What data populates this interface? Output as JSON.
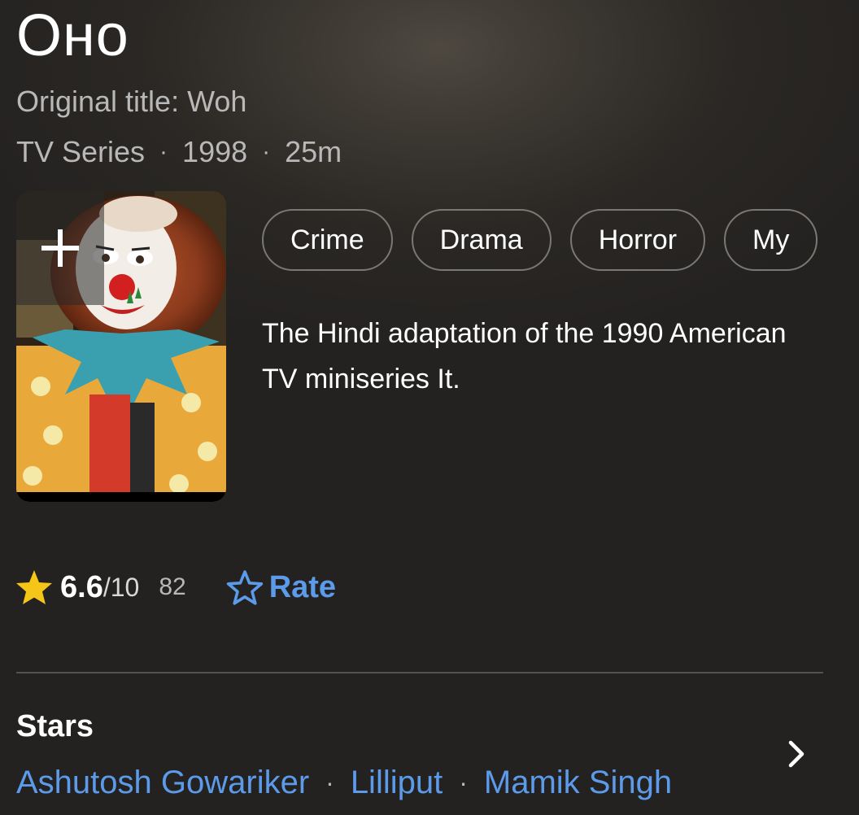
{
  "header": {
    "title": "Оно",
    "original_title": "Original title: Woh",
    "type": "TV Series",
    "year": "1998",
    "runtime": "25m",
    "separator": "·"
  },
  "poster": {
    "add_icon": "plus-icon"
  },
  "genres": [
    "Crime",
    "Drama",
    "Horror",
    "My"
  ],
  "plot": "The Hindi adaptation of the 1990 American TV miniseries It.",
  "rating": {
    "star_icon": "star-filled-icon",
    "score": "6.6",
    "out_of": "/10",
    "votes": "82",
    "rate_icon": "star-outline-icon",
    "rate_label": "Rate"
  },
  "stars": {
    "heading": "Stars",
    "names": [
      "Ashutosh Gowariker",
      "Lilliput",
      "Mamik Singh"
    ],
    "separator": "·",
    "more_icon": "chevron-right-icon"
  },
  "colors": {
    "accent_blue": "#5b9bea",
    "star_yellow": "#f5c518",
    "chip_border": "#7b7772",
    "muted_text": "#b8b8b8"
  }
}
